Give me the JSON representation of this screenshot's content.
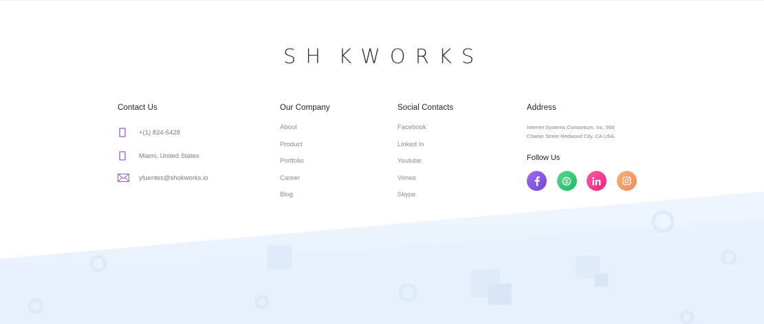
{
  "brand": {
    "logo_text_left": "SH",
    "logo_text_right": "KWORKS"
  },
  "contact": {
    "heading": "Contact Us",
    "phone": "+(1) 824-5428",
    "location": "Miami, United States",
    "email": "yfuentes@shokworks.io"
  },
  "company": {
    "heading": "Our Company",
    "links": [
      "About",
      "Product",
      "Portfolio",
      "Career",
      "Blog"
    ]
  },
  "social": {
    "heading": "Social Contacts",
    "links": [
      "Facebook",
      "Linked In",
      "Youtube",
      "Vimeo",
      "Skype"
    ]
  },
  "address": {
    "heading": "Address",
    "line1": "Internet Systems Consortium, Inc. 950",
    "line2": "Charter Street Redwood City, CA USA.",
    "follow_heading": "Follow Us",
    "icons": [
      "facebook-icon",
      "skype-icon",
      "linkedin-icon",
      "instagram-icon"
    ]
  },
  "colors": {
    "accent_purple": "#9b59d0",
    "footer_bg": "#eaf3fd"
  }
}
